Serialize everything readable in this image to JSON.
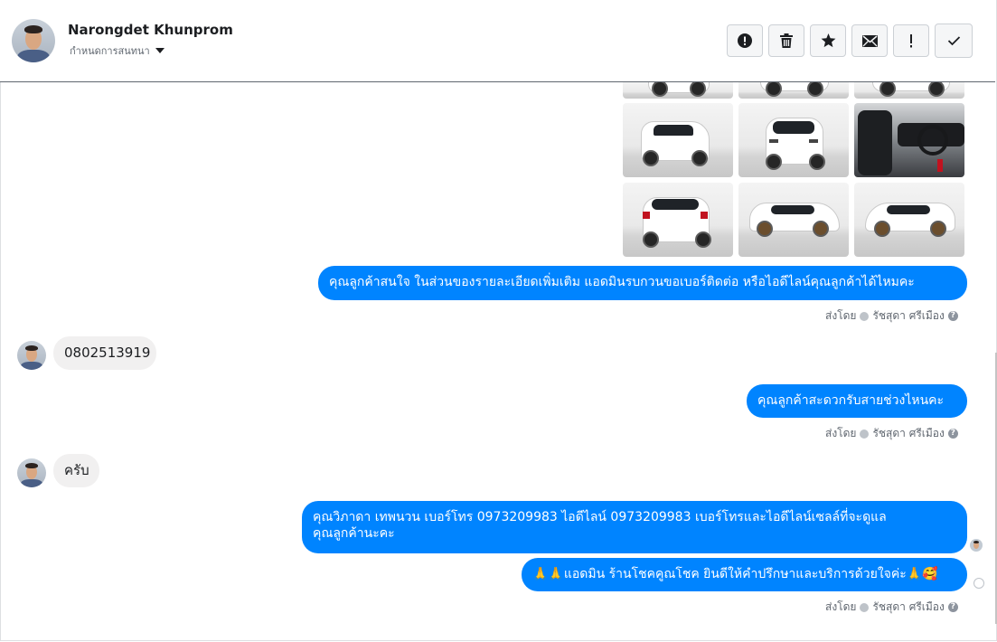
{
  "header": {
    "name": "Narongdet Khunprom",
    "subtitle": "กำหนดการสนทนา",
    "actions": [
      {
        "name": "mark-spam-button",
        "icon": "alert-circle-icon"
      },
      {
        "name": "delete-button",
        "icon": "trash-icon"
      },
      {
        "name": "star-button",
        "icon": "star-icon"
      },
      {
        "name": "mark-unread-button",
        "icon": "envelope-icon"
      },
      {
        "name": "follow-up-button",
        "icon": "exclamation-icon"
      },
      {
        "name": "mark-done-button",
        "icon": "check-icon"
      }
    ]
  },
  "messages": {
    "out1": "คุณลูกค้าสนใจ ในส่วนของรายละเอียดเพิ่มเติม แอดมินรบกวนขอเบอร์ติดต่อ หรือไอดีไลน์คุณลูกค้าได้ไหมคะ",
    "in1": "0802513919",
    "out2": "คุณลูกค้าสะดวกรับสายช่วงไหนคะ",
    "in2": "ครับ",
    "out3_line1": "คุณวิภาดา เทพนวน        เบอร์โทร 0973209983  ไอดีไลน์ 0973209983   เบอร์โทรและไอดีไลน์เซลล์ที่จะดูแล",
    "out3_line2": "คุณลูกค้านะคะ",
    "out4": "🙏🙏แอดมิน ร้านโชคคูณโชค ยินดีให้คำปรึกษาและบริการด้วยใจค่ะ🙏🥰"
  },
  "sent_by": {
    "label": "ส่งโดย",
    "agent": "รัชสุดา ศรีเมือง",
    "help": "?"
  },
  "colors": {
    "outgoing_bubble": "#0084ff",
    "incoming_bubble": "#f1f0f0"
  }
}
